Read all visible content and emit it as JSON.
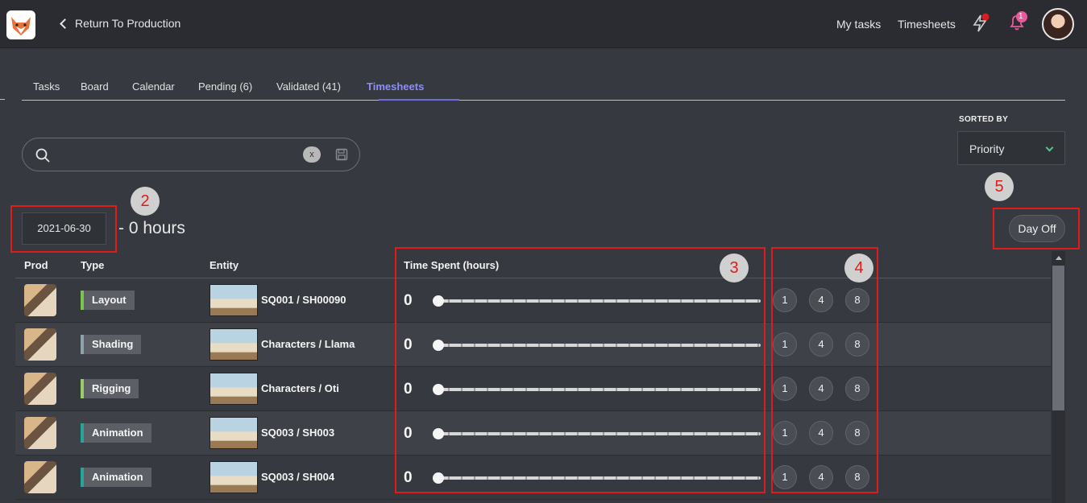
{
  "header": {
    "back_label": "Return To Production",
    "my_tasks": "My tasks",
    "timesheets": "Timesheets",
    "notification_count": "1"
  },
  "tabs": [
    {
      "label": "Tasks"
    },
    {
      "label": "Board"
    },
    {
      "label": "Calendar"
    },
    {
      "label": "Pending (6)"
    },
    {
      "label": "Validated (41)"
    },
    {
      "label": "Timesheets"
    }
  ],
  "search": {
    "value": "",
    "placeholder": "",
    "clear_label": "x"
  },
  "sort": {
    "label": "SORTED BY",
    "value": "Priority"
  },
  "date": "2021-06-30",
  "hours_text": "- 0 hours",
  "day_off_label": "Day Off",
  "annotations": [
    "2",
    "3",
    "4",
    "5"
  ],
  "table": {
    "headers": {
      "prod": "Prod",
      "type": "Type",
      "entity": "Entity",
      "time_spent": "Time Spent (hours)"
    },
    "rows": [
      {
        "type": "Layout",
        "type_color": "#7cc44e",
        "entity": "SQ001 / SH00090",
        "time": "0",
        "quick": [
          "1",
          "4",
          "8"
        ]
      },
      {
        "type": "Shading",
        "type_color": "#8fa3ad",
        "entity": "Characters / Llama",
        "time": "0",
        "quick": [
          "1",
          "4",
          "8"
        ]
      },
      {
        "type": "Rigging",
        "type_color": "#9ccc65",
        "entity": "Characters / Oti",
        "time": "0",
        "quick": [
          "1",
          "4",
          "8"
        ]
      },
      {
        "type": "Animation",
        "type_color": "#26a69a",
        "entity": "SQ003 / SH003",
        "time": "0",
        "quick": [
          "1",
          "4",
          "8"
        ]
      },
      {
        "type": "Animation",
        "type_color": "#26a69a",
        "entity": "SQ003 / SH004",
        "time": "0",
        "quick": [
          "1",
          "4",
          "8"
        ]
      }
    ]
  }
}
